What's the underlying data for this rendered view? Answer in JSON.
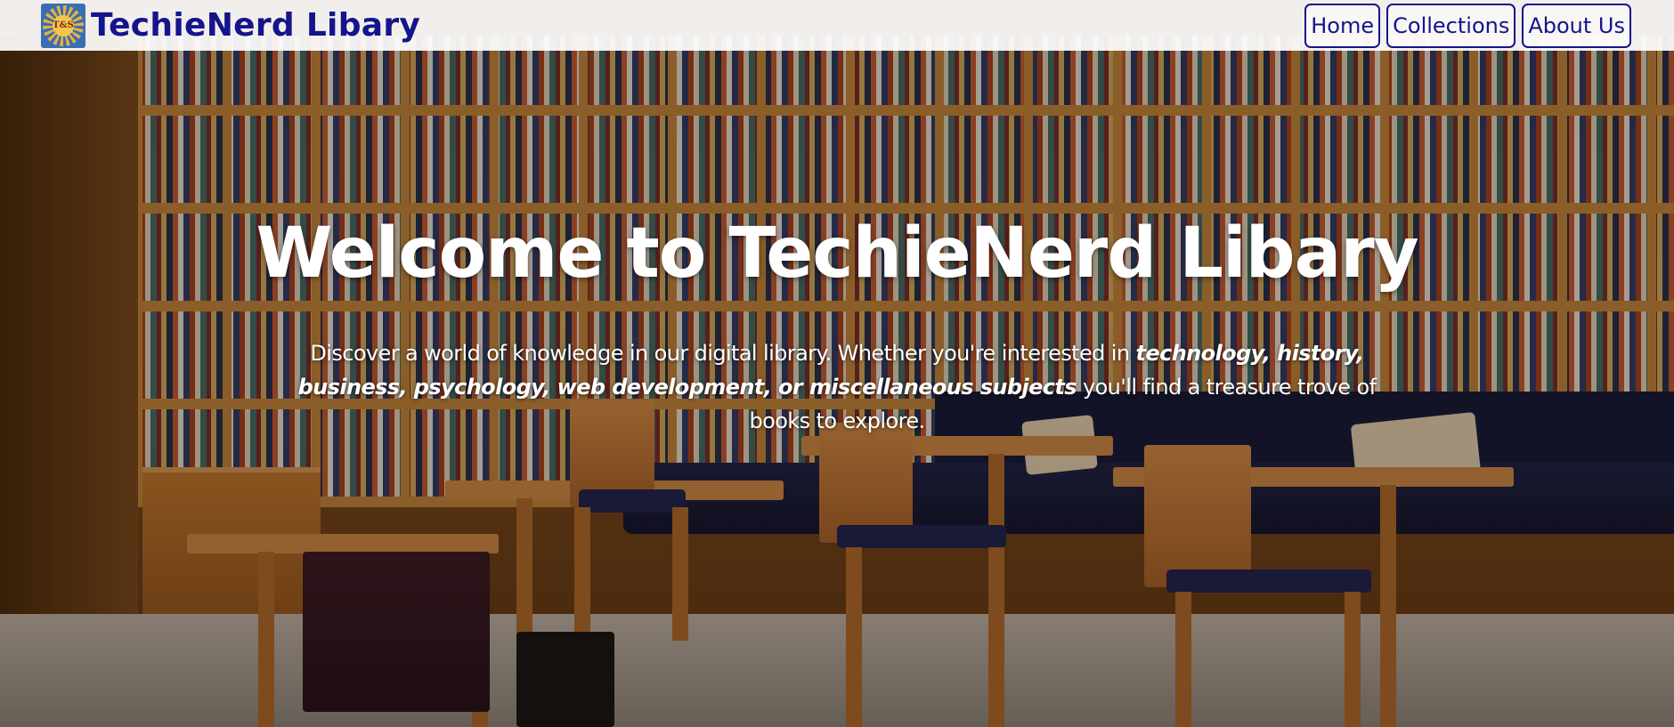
{
  "header": {
    "brand_name": "TechieNerd Libary",
    "logo_text": "T&S",
    "nav": [
      {
        "label": "Home"
      },
      {
        "label": "Collections"
      },
      {
        "label": "About Us"
      }
    ]
  },
  "hero": {
    "title": "Welcome to TechieNerd Libary",
    "intro_before": "Discover a world of knowledge in our digital library. Whether you're interested in ",
    "intro_emphasis": "technology, history, business, psychology, web development, or miscellaneous subjects",
    "intro_after": " you'll find a treasure trove of books to explore."
  },
  "colors": {
    "brand": "#14148c",
    "header_bg": "#ffffff",
    "hero_text": "#ffffff"
  }
}
